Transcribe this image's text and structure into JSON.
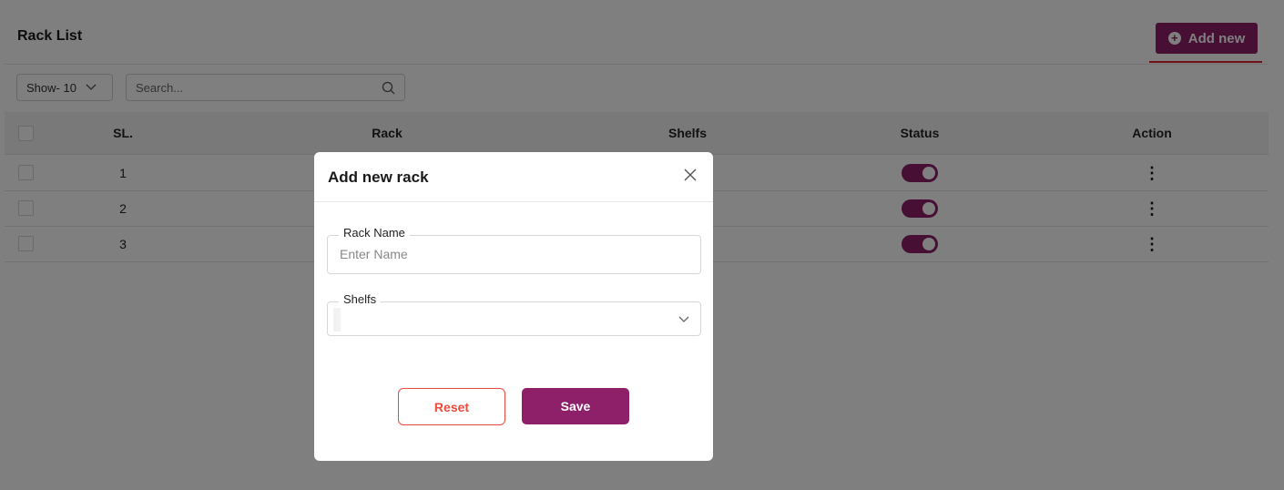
{
  "header": {
    "title": "Rack List",
    "add_label": "Add new"
  },
  "toolbar": {
    "show_label": "Show- 10",
    "search_placeholder": "Search..."
  },
  "table": {
    "columns": [
      "SL.",
      "Rack",
      "Shelfs",
      "Status",
      "Action"
    ],
    "rows": [
      {
        "sl": "1",
        "status": true
      },
      {
        "sl": "2",
        "status": true
      },
      {
        "sl": "3",
        "status": true
      }
    ]
  },
  "modal": {
    "title": "Add new rack",
    "rack_name_label": "Rack Name",
    "rack_name_placeholder": "Enter Name",
    "rack_name_value": "",
    "shelfs_label": "Shelfs",
    "shelfs_value": "",
    "reset_label": "Reset",
    "save_label": "Save"
  },
  "colors": {
    "accent": "#8e1f69",
    "reset": "#ec4a3b",
    "underline": "#e4252f"
  },
  "icons": {
    "add": "plus-circle-icon",
    "search": "search-icon",
    "close": "close-icon",
    "dropdown": "chevron-down-icon",
    "action": "vertical-dots-icon"
  }
}
